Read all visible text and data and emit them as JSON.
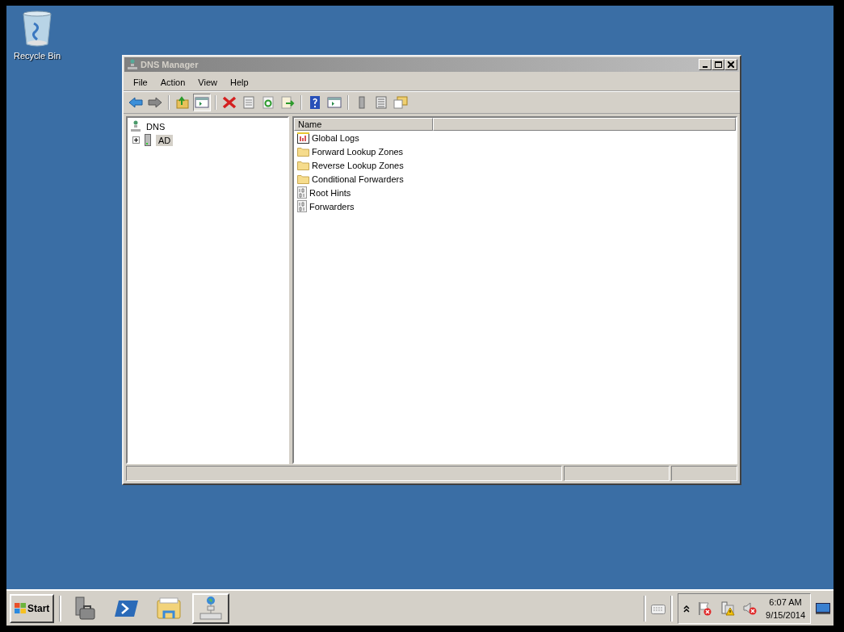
{
  "desktop": {
    "icons": [
      {
        "label": "Recycle Bin"
      }
    ]
  },
  "window": {
    "title": "DNS Manager",
    "active": false
  },
  "menu": [
    "File",
    "Action",
    "View",
    "Help"
  ],
  "toolbar": [
    [
      {
        "kind": "back",
        "pressed": false
      },
      {
        "kind": "forward",
        "pressed": false
      }
    ],
    [
      {
        "kind": "up",
        "pressed": false
      },
      {
        "kind": "tree",
        "pressed": true
      }
    ],
    [
      {
        "kind": "delete",
        "pressed": false
      },
      {
        "kind": "properties",
        "pressed": false
      },
      {
        "kind": "refresh",
        "pressed": false
      },
      {
        "kind": "export",
        "pressed": false
      }
    ],
    [
      {
        "kind": "help",
        "pressed": false
      },
      {
        "kind": "pane",
        "pressed": false
      }
    ],
    [
      {
        "kind": "server",
        "pressed": false
      },
      {
        "kind": "list",
        "pressed": false
      },
      {
        "kind": "folders",
        "pressed": false
      }
    ]
  ],
  "tree": [
    {
      "label": "DNS",
      "kind": "dns",
      "selected": false,
      "children": [
        {
          "label": "AD",
          "kind": "server",
          "selected": true,
          "expanded": false
        }
      ]
    }
  ],
  "list": {
    "columns": [
      {
        "label": "Name"
      }
    ],
    "rows": [
      {
        "label": "Global Logs",
        "kind": "log"
      },
      {
        "label": "Forward Lookup Zones",
        "kind": "folder"
      },
      {
        "label": "Reverse Lookup Zones",
        "kind": "folder"
      },
      {
        "label": "Conditional Forwarders",
        "kind": "folder"
      },
      {
        "label": "Root Hints",
        "kind": "binary"
      },
      {
        "label": "Forwarders",
        "kind": "binary"
      }
    ]
  },
  "taskbar": {
    "start": "Start",
    "apps": [
      {
        "kind": "server-manager",
        "active": false
      },
      {
        "kind": "powershell",
        "active": false
      },
      {
        "kind": "explorer",
        "active": false
      },
      {
        "kind": "dns",
        "active": true
      }
    ],
    "time": "6:07 AM",
    "date": "9/15/2014"
  }
}
